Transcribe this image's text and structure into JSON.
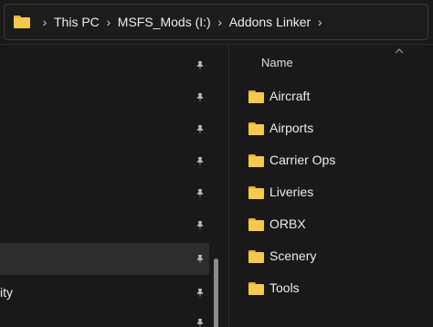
{
  "address_bar": {
    "folder_icon": "folder-icon",
    "crumbs": [
      "This PC",
      "MSFS_Mods (I:)",
      "Addons Linker"
    ],
    "separator": "›"
  },
  "nav_pane": {
    "selected_row_label": "",
    "partial_row_label": "ity",
    "pin_icon": "pin-icon"
  },
  "content": {
    "column_header": "Name",
    "items": [
      {
        "label": "Aircraft"
      },
      {
        "label": "Airports"
      },
      {
        "label": "Carrier Ops"
      },
      {
        "label": "Liveries"
      },
      {
        "label": "ORBX"
      },
      {
        "label": "Scenery"
      },
      {
        "label": "Tools"
      }
    ],
    "folder_color": "#f6c94e"
  }
}
